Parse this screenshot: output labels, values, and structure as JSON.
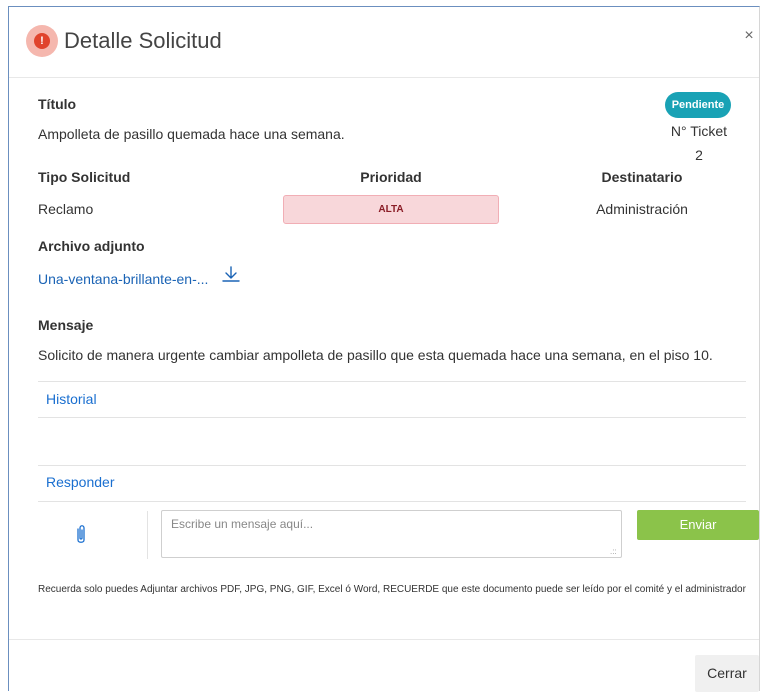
{
  "modal": {
    "title": "Detalle Solicitud",
    "alert_icon": "exclamation-circle-icon",
    "alert_symbol": "!",
    "close_symbol": "×"
  },
  "request": {
    "title_label": "Título",
    "title_value": "Ampolleta de pasillo quemada hace una semana.",
    "status_badge": "Pendiente",
    "ticket_label": "N° Ticket",
    "ticket_number": "2",
    "type_label": "Tipo Solicitud",
    "type_value": "Reclamo",
    "priority_label": "Prioridad",
    "priority_value": "ALTA",
    "recipient_label": "Destinatario",
    "recipient_value": "Administración",
    "attachment_label": "Archivo adjunto",
    "attachment_link": "Una-ventana-brillante-en-...",
    "message_label": "Mensaje",
    "message_value": "Solicito de manera urgente cambiar ampolleta de pasillo que esta quemada hace una semana, en el piso 10."
  },
  "sections": {
    "history_label": "Historial",
    "reply_label": "Responder"
  },
  "reply": {
    "placeholder": "Escribe un mensaje aquí...",
    "send_label": "Enviar",
    "notice": "Recuerda solo puedes Adjuntar archivos PDF, JPG, PNG, GIF, Excel ó Word, RECUERDE que este documento puede ser leído por el comité y el administrador",
    "resize_grip": ".::"
  },
  "footer": {
    "close_label": "Cerrar"
  },
  "colors": {
    "badge": "#19a2b5",
    "priority_bg": "#f8d7da",
    "priority_text": "#8a1c26",
    "link": "#1a63b5",
    "send_button": "#8bc34a",
    "alert_icon": "#e0442d"
  }
}
